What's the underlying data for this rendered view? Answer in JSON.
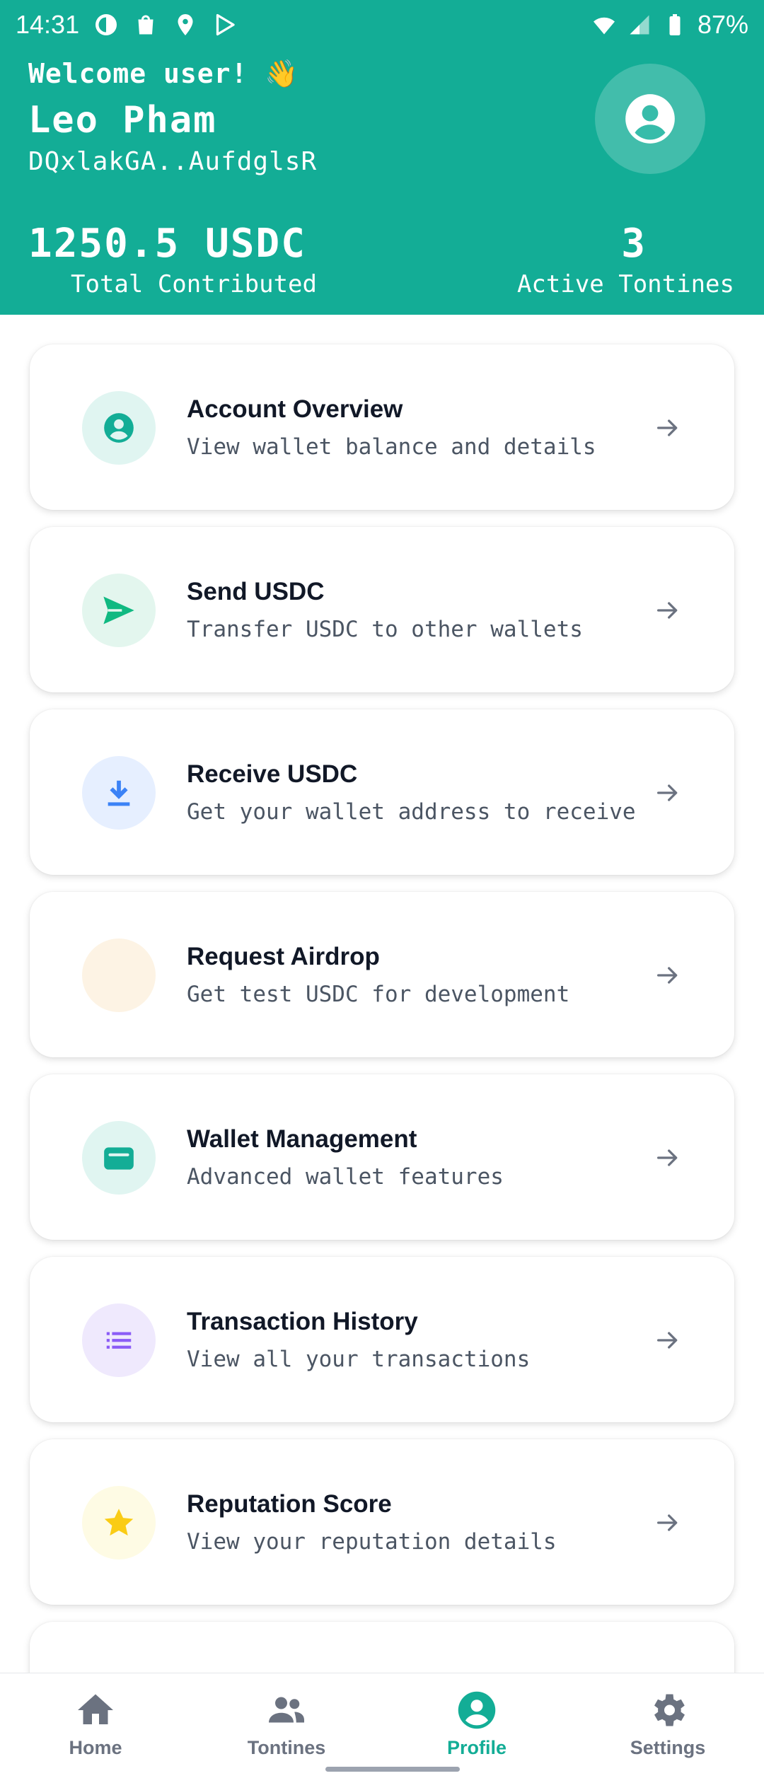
{
  "status_bar": {
    "time": "14:31",
    "battery": "87%"
  },
  "header": {
    "welcome": "Welcome user! 👋",
    "name": "Leo Pham",
    "wallet_address": "DQxlakGA..AufdglsR",
    "total_value": "1250.5 USDC",
    "total_label": "Total Contributed",
    "active_value": "3",
    "active_label": "Active Tontines"
  },
  "menu": {
    "items": [
      {
        "title": "Account Overview",
        "subtitle": "View wallet balance and details",
        "icon": "account-circle-icon",
        "icon_bg": "#e0f5f1",
        "icon_color": "#13ad96"
      },
      {
        "title": "Send USDC",
        "subtitle": "Transfer USDC to other wallets",
        "icon": "send-icon",
        "icon_bg": "#e3f6ee",
        "icon_color": "#10b981"
      },
      {
        "title": "Receive USDC",
        "subtitle": "Get your wallet address to receive",
        "icon": "download-icon",
        "icon_bg": "#e6efff",
        "icon_color": "#3b82f6"
      },
      {
        "title": "Request Airdrop",
        "subtitle": "Get test USDC for development",
        "icon": "airdrop-icon",
        "icon_bg": "#fdf3e4",
        "icon_color": "#f59e0b"
      },
      {
        "title": "Wallet Management",
        "subtitle": "Advanced wallet features",
        "icon": "wallet-icon",
        "icon_bg": "#e0f5f1",
        "icon_color": "#13ad96"
      },
      {
        "title": "Transaction History",
        "subtitle": "View all your transactions",
        "icon": "list-icon",
        "icon_bg": "#efe9fd",
        "icon_color": "#8b5cf6"
      },
      {
        "title": "Reputation Score",
        "subtitle": "View your reputation details",
        "icon": "star-icon",
        "icon_bg": "#fefbe4",
        "icon_color": "#facc15"
      }
    ]
  },
  "bottom_nav": {
    "items": [
      {
        "label": "Home",
        "icon": "home-icon"
      },
      {
        "label": "Tontines",
        "icon": "group-icon"
      },
      {
        "label": "Profile",
        "icon": "account-circle-icon",
        "active": true
      },
      {
        "label": "Settings",
        "icon": "gear-icon"
      }
    ]
  },
  "colors": {
    "accent": "#13ad96",
    "inactive": "#6b7280"
  }
}
